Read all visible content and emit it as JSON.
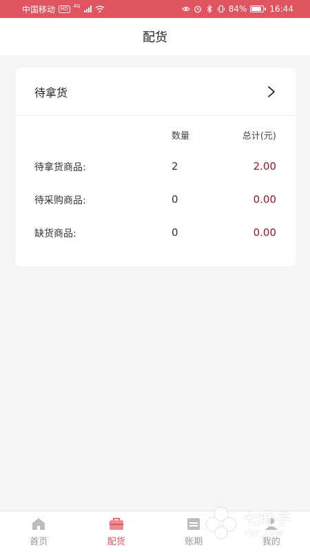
{
  "status_bar": {
    "carrier": "中国移动",
    "hd": "HD",
    "network": "4G",
    "battery": "84%",
    "battery_level": 0.84,
    "time": "16:44"
  },
  "nav": {
    "title": "配货"
  },
  "card": {
    "header_label": "待拿货",
    "columns": {
      "quantity": "数量",
      "total": "总计(元)"
    },
    "rows": [
      {
        "label": "待拿货商品:",
        "quantity": "2",
        "total": "2.00"
      },
      {
        "label": "待采购商品:",
        "quantity": "0",
        "total": "0.00"
      },
      {
        "label": "缺货商品:",
        "quantity": "0",
        "total": "0.00"
      }
    ]
  },
  "tabs": [
    {
      "label": "首页",
      "icon": "home-icon",
      "active": false
    },
    {
      "label": "配货",
      "icon": "briefcase-icon",
      "active": true
    },
    {
      "label": "账期",
      "icon": "calendar-icon",
      "active": false
    },
    {
      "label": "我的",
      "icon": "user-icon",
      "active": false
    }
  ],
  "watermark": {
    "main": "七叶子",
    "sub": "7YZ.COM"
  },
  "colors": {
    "accent": "#e0545f",
    "amount": "#8b1a2e",
    "inactive": "#999999",
    "background": "#f5f5f5"
  }
}
